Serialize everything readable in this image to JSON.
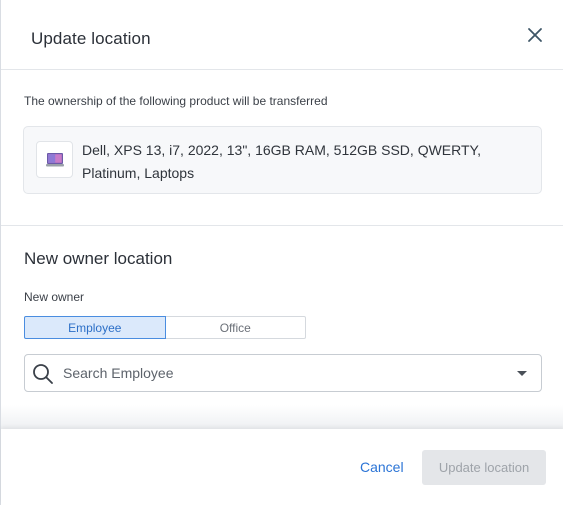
{
  "dialog": {
    "title": "Update location",
    "close_icon": "close-icon"
  },
  "transfer": {
    "description": "The ownership of the following product will be transferred",
    "product": {
      "name": "Dell, XPS 13, i7, 2022, 13\", 16GB RAM, 512GB SSD, QWERTY, Platinum, Laptops",
      "thumbnail_icon": "laptop-icon"
    }
  },
  "new_owner_location": {
    "section_title": "New owner location",
    "field_label": "New owner",
    "toggle": {
      "options": [
        "Employee",
        "Office"
      ],
      "selected": "Employee"
    },
    "search": {
      "placeholder": "Search Employee",
      "value": "",
      "icon": "search-icon",
      "dropdown_icon": "caret-down-icon"
    }
  },
  "footer": {
    "cancel_label": "Cancel",
    "submit_label": "Update location",
    "submit_disabled": true
  },
  "colors": {
    "accent": "#2b74d6",
    "toggle_active_bg": "#dbe9fb",
    "disabled_bg": "#e4e6e9"
  }
}
